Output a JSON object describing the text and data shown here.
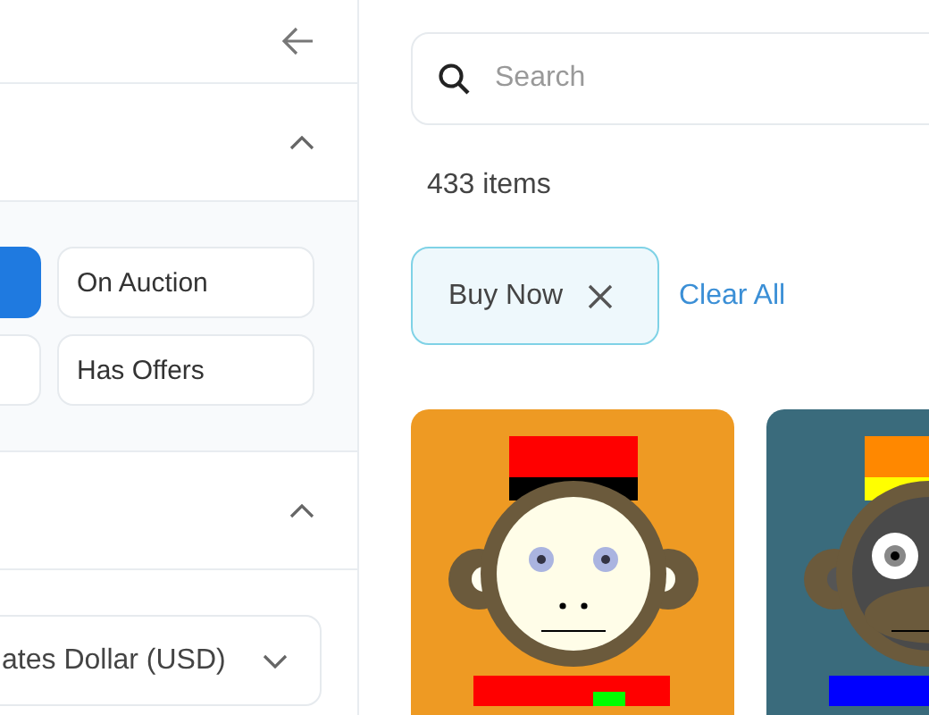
{
  "sidebar": {
    "sections": [
      {
        "expanded": true,
        "filters": [
          {
            "selected": true
          },
          {
            "label": "On Auction",
            "selected": false
          },
          {
            "selected": false
          },
          {
            "label": "Has Offers",
            "selected": false
          }
        ]
      },
      {
        "expanded": true,
        "currency": {
          "value": "ates Dollar (USD)"
        }
      }
    ]
  },
  "search": {
    "placeholder": "Search"
  },
  "result_count": "433 items",
  "active_filters": [
    {
      "label": "Buy Now"
    }
  ],
  "clear_all": "Clear All",
  "items": [
    {
      "kind": "light-face",
      "color": "#ee9a23"
    },
    {
      "kind": "dark-face",
      "color": "#3a6b7c"
    }
  ]
}
